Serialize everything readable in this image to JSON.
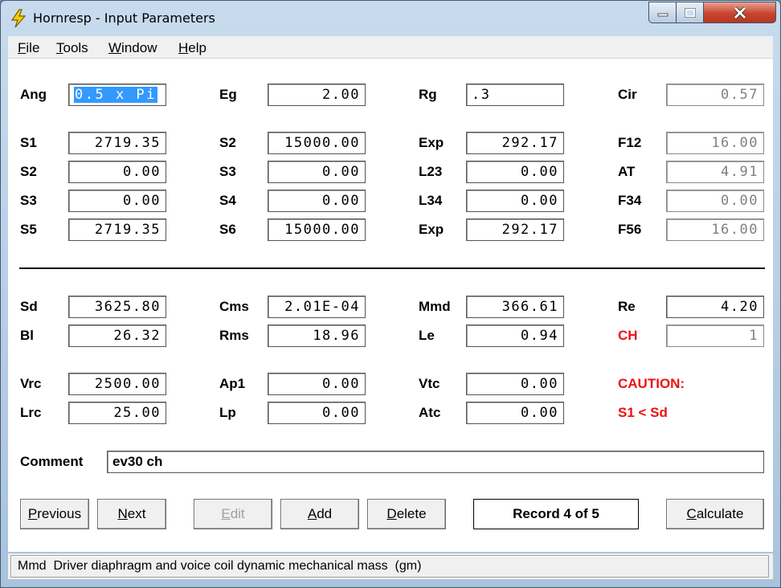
{
  "window": {
    "title": "Hornresp - Input Parameters"
  },
  "menu": [
    {
      "label": "File",
      "key": "F",
      "rest": "ile"
    },
    {
      "label": "Tools",
      "key": "T",
      "rest": "ools"
    },
    {
      "label": "Window",
      "key": "W",
      "rest": "indow"
    },
    {
      "label": "Help",
      "key": "H",
      "rest": "elp"
    }
  ],
  "row_ang": {
    "ang_label": "Ang",
    "ang_value": "0.5 x Pi",
    "eg_label": "Eg",
    "eg_value": "2.00",
    "rg_label": "Rg",
    "rg_value": ".3",
    "cir_label": "Cir",
    "cir_value": "0.57"
  },
  "horn": [
    {
      "a_label": "S1",
      "a_value": "2719.35",
      "b_label": "S2",
      "b_value": "15000.00",
      "c_label": "Exp",
      "c_value": "292.17",
      "d_label": "F12",
      "d_value": "16.00"
    },
    {
      "a_label": "S2",
      "a_value": "0.00",
      "b_label": "S3",
      "b_value": "0.00",
      "c_label": "L23",
      "c_value": "0.00",
      "d_label": "AT",
      "d_value": "4.91"
    },
    {
      "a_label": "S3",
      "a_value": "0.00",
      "b_label": "S4",
      "b_value": "0.00",
      "c_label": "L34",
      "c_value": "0.00",
      "d_label": "F34",
      "d_value": "0.00"
    },
    {
      "a_label": "S5",
      "a_value": "2719.35",
      "b_label": "S6",
      "b_value": "15000.00",
      "c_label": "Exp",
      "c_value": "292.17",
      "d_label": "F56",
      "d_value": "16.00"
    }
  ],
  "driver": {
    "sd_label": "Sd",
    "sd_value": "3625.80",
    "cms_label": "Cms",
    "cms_value": "2.01E-04",
    "mmd_label": "Mmd",
    "mmd_value": "366.61",
    "re_label": "Re",
    "re_value": "4.20",
    "bl_label": "Bl",
    "bl_value": "26.32",
    "rms_label": "Rms",
    "rms_value": "18.96",
    "le_label": "Le",
    "le_value": "0.94",
    "ch_label": "CH",
    "ch_value": "1"
  },
  "chamber": {
    "vrc_label": "Vrc",
    "vrc_value": "2500.00",
    "ap1_label": "Ap1",
    "ap1_value": "0.00",
    "vtc_label": "Vtc",
    "vtc_value": "0.00",
    "lrc_label": "Lrc",
    "lrc_value": "25.00",
    "lp_label": "Lp",
    "lp_value": "0.00",
    "atc_label": "Atc",
    "atc_value": "0.00",
    "caution_title": "CAUTION:",
    "caution_text": "S1 < Sd"
  },
  "comment": {
    "label": "Comment",
    "value": "ev30 ch"
  },
  "buttons": {
    "previous": {
      "key": "P",
      "rest": "revious"
    },
    "next": {
      "key": "N",
      "rest": "ext"
    },
    "edit": {
      "key": "E",
      "rest": "dit"
    },
    "add": {
      "key": "A",
      "rest": "dd"
    },
    "delete": {
      "key": "D",
      "rest": "elete"
    },
    "calculate": {
      "key": "C",
      "rest": "alculate"
    }
  },
  "record": "Record 4 of 5",
  "status": "Mmd  Driver diaphragm and voice coil dynamic mechanical mass  (gm)",
  "colors": {
    "accent_red": "#ee1111",
    "selection": "#3399ff"
  }
}
